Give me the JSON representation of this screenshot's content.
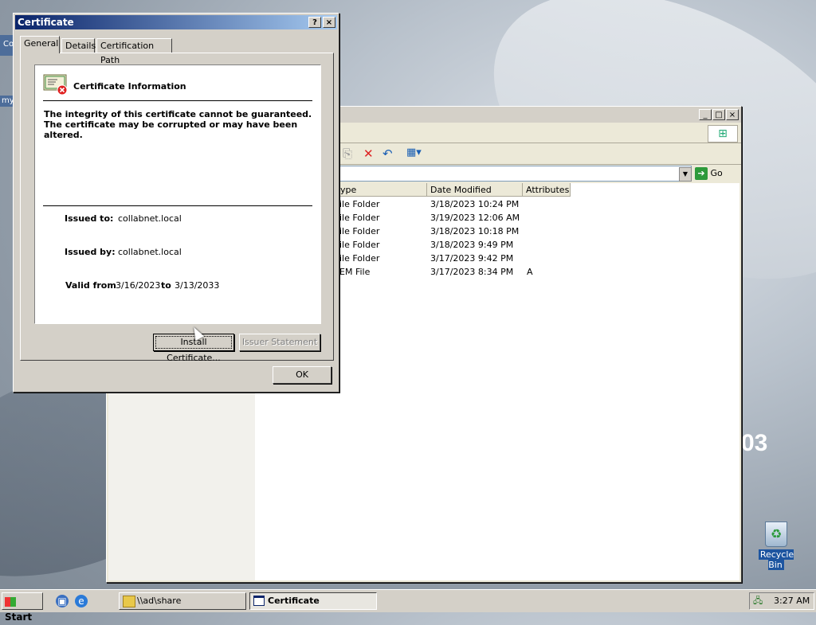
{
  "desktop": {
    "text_fragment": "03",
    "left_strip_1": "Co",
    "left_strip_2": "my",
    "recycle_bin_label": "Recycle Bin"
  },
  "explorer": {
    "go_label": "Go",
    "columns": [
      "ype",
      "Date Modified",
      "Attributes"
    ],
    "rows": [
      {
        "type": "ile Folder",
        "date": "3/18/2023 10:24 PM",
        "attr": ""
      },
      {
        "type": "ile Folder",
        "date": "3/19/2023 12:06 AM",
        "attr": ""
      },
      {
        "type": "ile Folder",
        "date": "3/18/2023 10:18 PM",
        "attr": ""
      },
      {
        "type": "ile Folder",
        "date": "3/18/2023 9:49 PM",
        "attr": ""
      },
      {
        "type": "ile Folder",
        "date": "3/17/2023 9:42 PM",
        "attr": ""
      },
      {
        "type": "EM File",
        "date": "3/17/2023 8:34 PM",
        "attr": "A"
      }
    ]
  },
  "certificate": {
    "title": "Certificate",
    "help_label": "?",
    "close_label": "×",
    "tabs": [
      "General",
      "Details",
      "Certification Path"
    ],
    "info_title": "Certificate Information",
    "warning": "The integrity of this certificate cannot be guaranteed. The certificate may be corrupted or may have been altered.",
    "issued_to_label": "Issued to:",
    "issued_to": "collabnet.local",
    "issued_by_label": "Issued by:",
    "issued_by": "collabnet.local",
    "valid_from_label": "Valid from",
    "valid_from": "3/16/2023",
    "to_label": "to",
    "valid_to": "3/13/2033",
    "install_button": "Install Certificate...",
    "issuer_statement_button": "Issuer Statement",
    "ok_button": "OK"
  },
  "taskbar": {
    "start_label": "Start",
    "tasks": [
      {
        "label": "\\\\ad\\share",
        "active": false
      },
      {
        "label": "Certificate",
        "active": true
      }
    ],
    "clock": "3:27 AM"
  }
}
